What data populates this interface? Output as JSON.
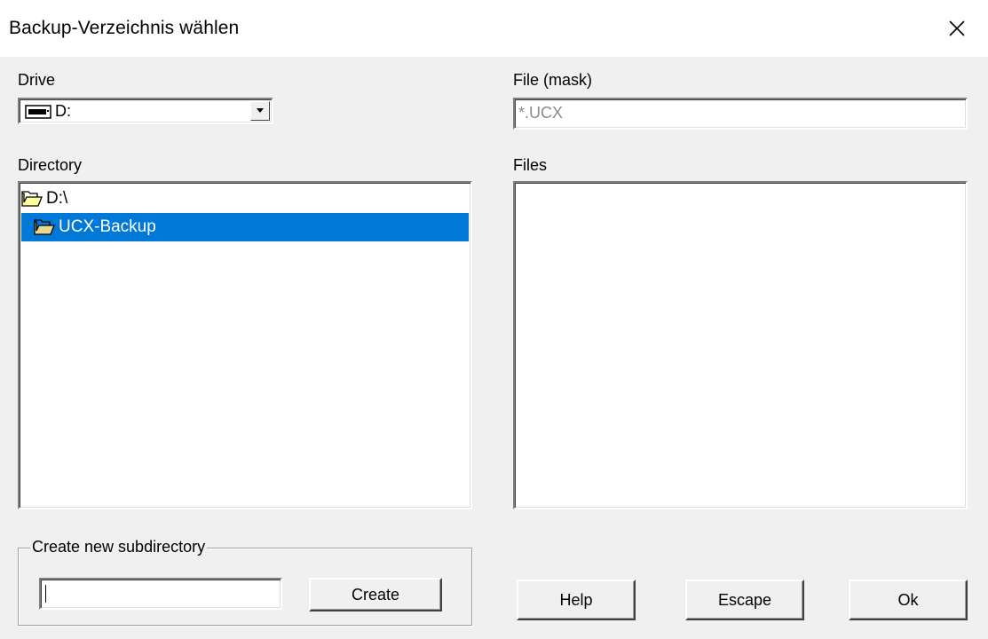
{
  "window": {
    "title": "Backup-Verzeichnis wählen"
  },
  "labels": {
    "drive": "Drive",
    "file_mask": "File (mask)",
    "directory": "Directory",
    "files": "Files",
    "create_group": "Create new subdirectory"
  },
  "drive": {
    "value": "D:",
    "icon": "drive-icon"
  },
  "file_mask": {
    "value": "*.UCX"
  },
  "directory_list": [
    {
      "label": "D:\\",
      "icon": "folder-open-icon",
      "selected": false
    },
    {
      "label": "UCX-Backup",
      "icon": "folder-open-icon",
      "selected": true
    }
  ],
  "files_list": [],
  "new_subdirectory": {
    "value": ""
  },
  "buttons": {
    "create": "Create",
    "help": "Help",
    "escape": "Escape",
    "ok": "Ok"
  },
  "colors": {
    "selection": "#0078d7",
    "dialog_bg": "#f0f0f0"
  }
}
